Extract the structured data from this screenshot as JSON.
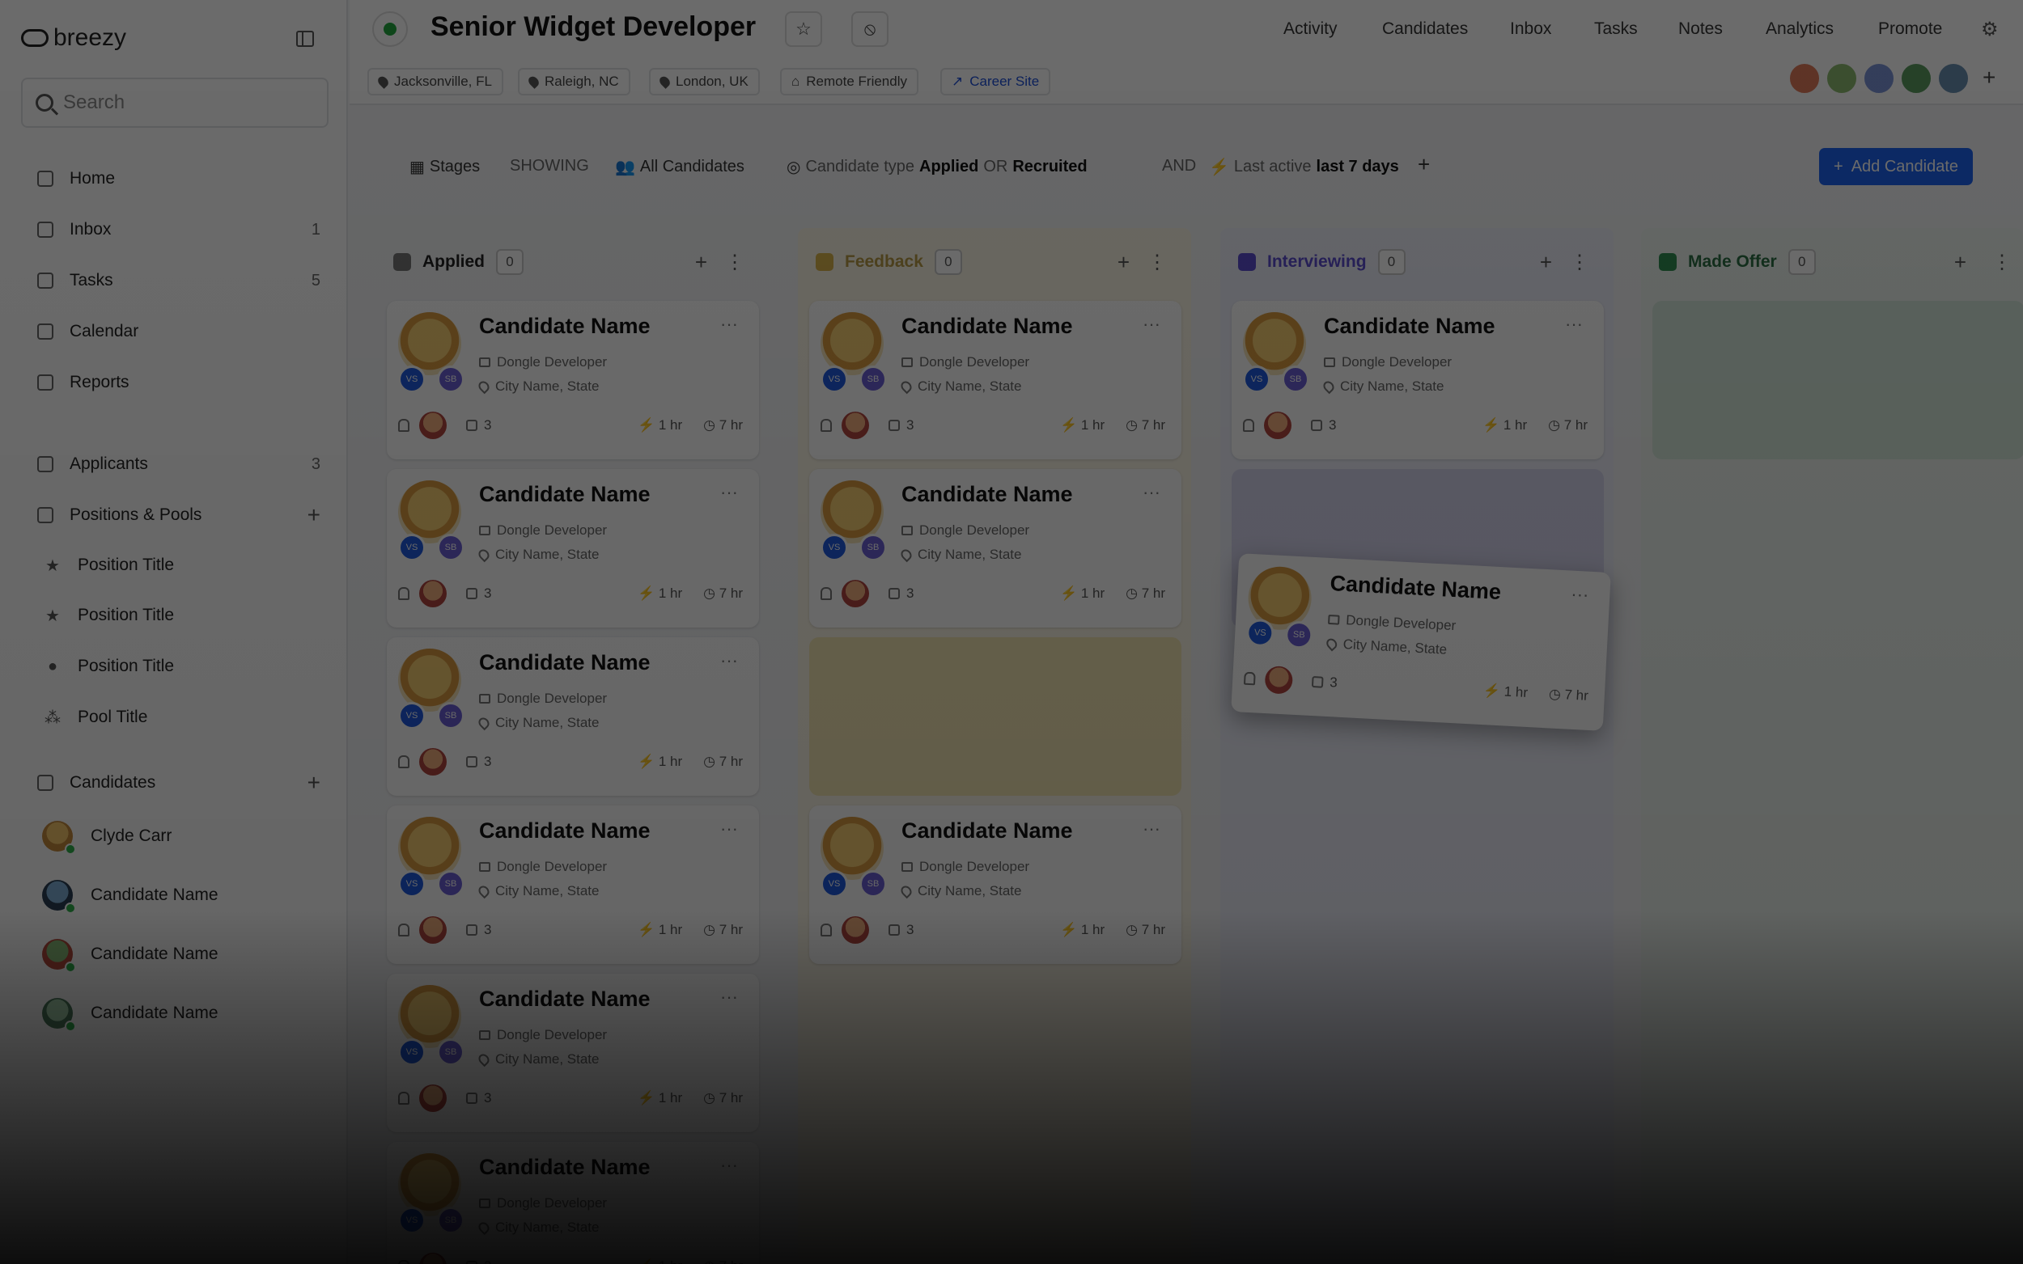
{
  "sidebar": {
    "brand": "breezy",
    "search_placeholder": "Search",
    "nav": [
      {
        "label": "Home",
        "count": ""
      },
      {
        "label": "Inbox",
        "count": "1"
      },
      {
        "label": "Tasks",
        "count": "5"
      },
      {
        "label": "Calendar",
        "count": ""
      },
      {
        "label": "Reports",
        "count": ""
      }
    ],
    "applicants": {
      "label": "Applicants",
      "count": "3"
    },
    "positions_header": "Positions & Pools",
    "positions": [
      "Position Title",
      "Position Title",
      "Position Title",
      "Pool Title"
    ],
    "candidates_header": "Candidates",
    "candidates": [
      "Clyde Carr",
      "Candidate Name",
      "Candidate Name",
      "Candidate Name"
    ]
  },
  "header": {
    "title": "Senior Widget Developer",
    "nav": [
      "Activity",
      "Candidates",
      "Inbox",
      "Tasks",
      "Notes",
      "Analytics",
      "Promote"
    ],
    "locations": [
      "Jacksonville, FL",
      "Raleigh, NC",
      "London, UK",
      "Remote Friendly"
    ],
    "career_site": "Career Site"
  },
  "filters": {
    "stages": "Stages",
    "showing": "SHOWING",
    "all_candidates": "All Candidates",
    "type_label": "Candidate type",
    "type_applied": "Applied",
    "or": "OR",
    "type_recruited": "Recruited",
    "and": "AND",
    "active_label": "Last active",
    "active_value": "last 7 days",
    "add_button": "Add Candidate"
  },
  "columns": [
    {
      "name": "Applied",
      "count": "0",
      "color": "#ffffff"
    },
    {
      "name": "Feedback",
      "count": "0",
      "color": "#fff7dc"
    },
    {
      "name": "Interviewing",
      "count": "0",
      "color": "#eef0fb"
    },
    {
      "name": "Made Offer",
      "count": "0",
      "color": "#eef7f1"
    }
  ],
  "card": {
    "name": "Candidate Name",
    "role": "Dongle Developer",
    "location": "City Name, State",
    "tasks": "3",
    "last_active": "1 hr",
    "time_in_stage": "7 hr",
    "badge_a": "VS",
    "badge_b": "SB"
  },
  "colors": {
    "accent": "#1e63f0",
    "status_green": "#21a83f"
  }
}
